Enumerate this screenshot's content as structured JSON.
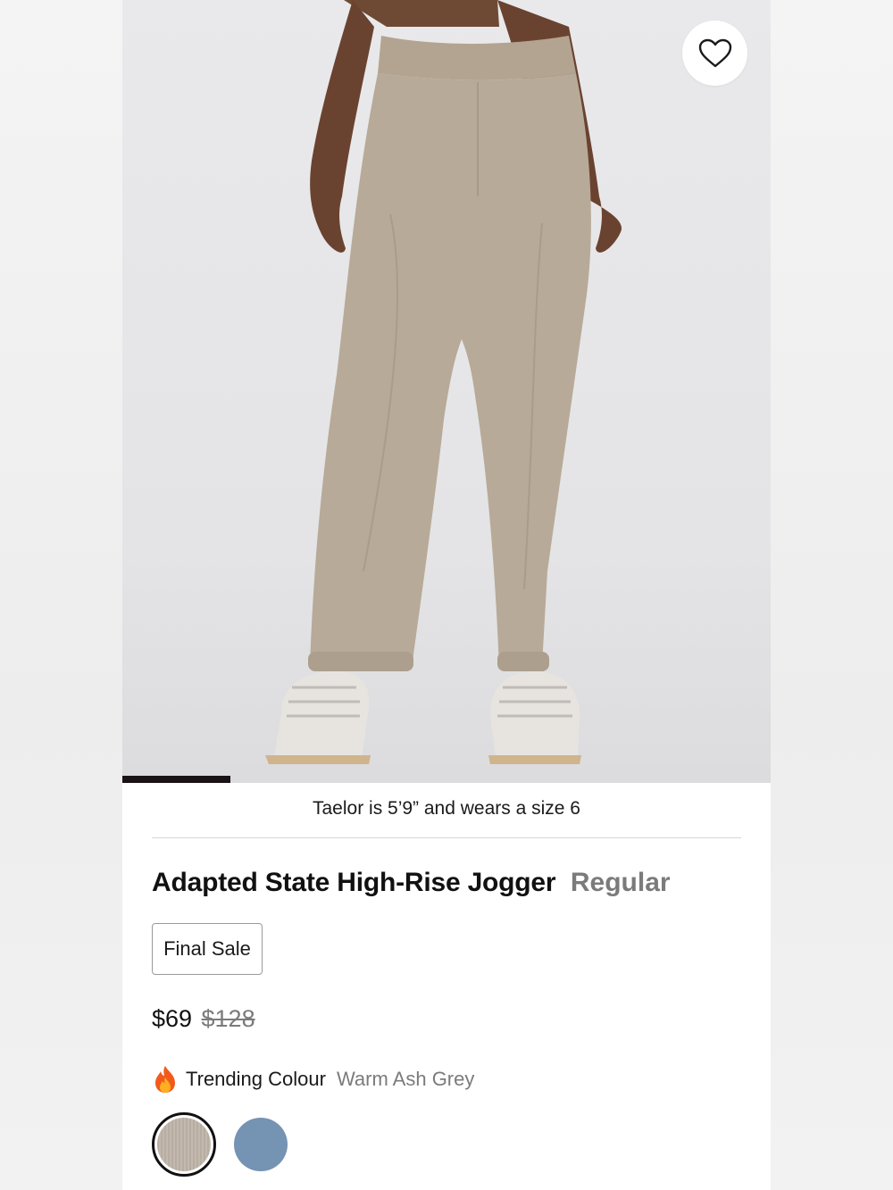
{
  "product": {
    "model_caption": "Taelor is 5’9” and wears a size 6",
    "title": "Adapted State High-Rise Jogger",
    "variant": "Regular",
    "badge": "Final Sale",
    "price": "$69",
    "original_price": "$128",
    "trending_label": "Trending Colour",
    "colour_name": "Warm Ash Grey",
    "image_gallery": {
      "current_slide": 1,
      "progress_fraction": 0.17
    }
  },
  "icons": {
    "wishlist": "heart-outline-icon",
    "trending": "fire-emoji-icon"
  },
  "swatches": [
    {
      "name": "Warm Ash Grey",
      "color": "#bdb2a7",
      "selected": true
    },
    {
      "name": "blue",
      "color": "#7593b3",
      "selected": false
    }
  ],
  "colors": {
    "pants": "#b8aa98",
    "text_primary": "#111111",
    "text_secondary": "#7b7b7b"
  }
}
